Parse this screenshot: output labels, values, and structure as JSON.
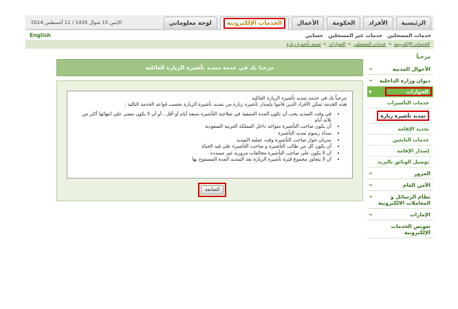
{
  "header": {
    "date": "الإثنين 15 شوال 1435 / 11 أغسطس 2014",
    "tabs": [
      {
        "label": "الرئيسية"
      },
      {
        "label": "الأفراد"
      },
      {
        "label": "الحكومة"
      },
      {
        "label": "الأعمال"
      },
      {
        "label": "الخدمات الإلكترونية"
      },
      {
        "label": "لوحة معلوماتي"
      }
    ],
    "language": "English",
    "subnav": [
      "خدمات المسجلين",
      "خدمات غير المسجلين",
      "حسابي"
    ]
  },
  "breadcrumb": [
    "الخدمات الإلكترونية",
    "خدمات المسجلين",
    "الجوازات",
    "تمديد تأشيرة زيارة"
  ],
  "sidebar": {
    "welcome": "مرحباً",
    "items": [
      {
        "label": "الأحوال المدنية"
      },
      {
        "label": "ديوان وزارة الداخلية"
      },
      {
        "label": "الجوازات"
      },
      {
        "label": "المرور"
      },
      {
        "label": "الأمن العام"
      },
      {
        "label": "نظام الرسائل و المعاملات الالكترونية"
      },
      {
        "label": "الإمارات"
      },
      {
        "label": "تعويض الخدمات الإلكترونية"
      }
    ],
    "passport_subitems": [
      {
        "label": "خدمات التأشيرات"
      },
      {
        "label": "تمديد تأشيرة زيارة"
      },
      {
        "label": "تجديد الإقامة"
      },
      {
        "label": "خدمات التابعين"
      },
      {
        "label": "إصدار الإقامة"
      },
      {
        "label": "توصيل الوثائق بالبريد"
      }
    ]
  },
  "main": {
    "title": "مرحبا بك في خدمة تمديد تأشيرة الزيارة العائلية",
    "intro_line1": "مرحباً بك في خدمة تمديد تأشيرة الزيارة العائلية",
    "intro_line2": "هذه الخدمة تمكن الأفراد الذين قاموا بإصدار تأشيرة زيارة من تمديد تأشيرة الزيارة بحسب قواعد الخدمة التالية :",
    "rules": [
      "في وقت التمديد يجب أن تكون المدة المتبقية في صلاحية التأشيرة سبعة أيام أو أقل ، أو أن لا يكون مضى على انتهائها أكثر من ثلاثة أيام",
      "أن يكون صاحب التأشيرة متواجد داخل المملكة العربية السعودية",
      "سداد رسوم تمديد التأشيرة",
      "سريان جواز صاحب التأشيرة وقت عملية التمديد",
      "أن يكون كل من طالب التأشيرة و صاحب التأشيرة على قيد الحياة",
      "أن لا يكون على صاحب التأشيرة مخالفات مرورية غير مسددة",
      "أن لا يتجاوز مجموع فترة تأشيرة الزيارة بعد التمديد المدة المسموح بها"
    ],
    "continue_label": "المتابعة"
  }
}
